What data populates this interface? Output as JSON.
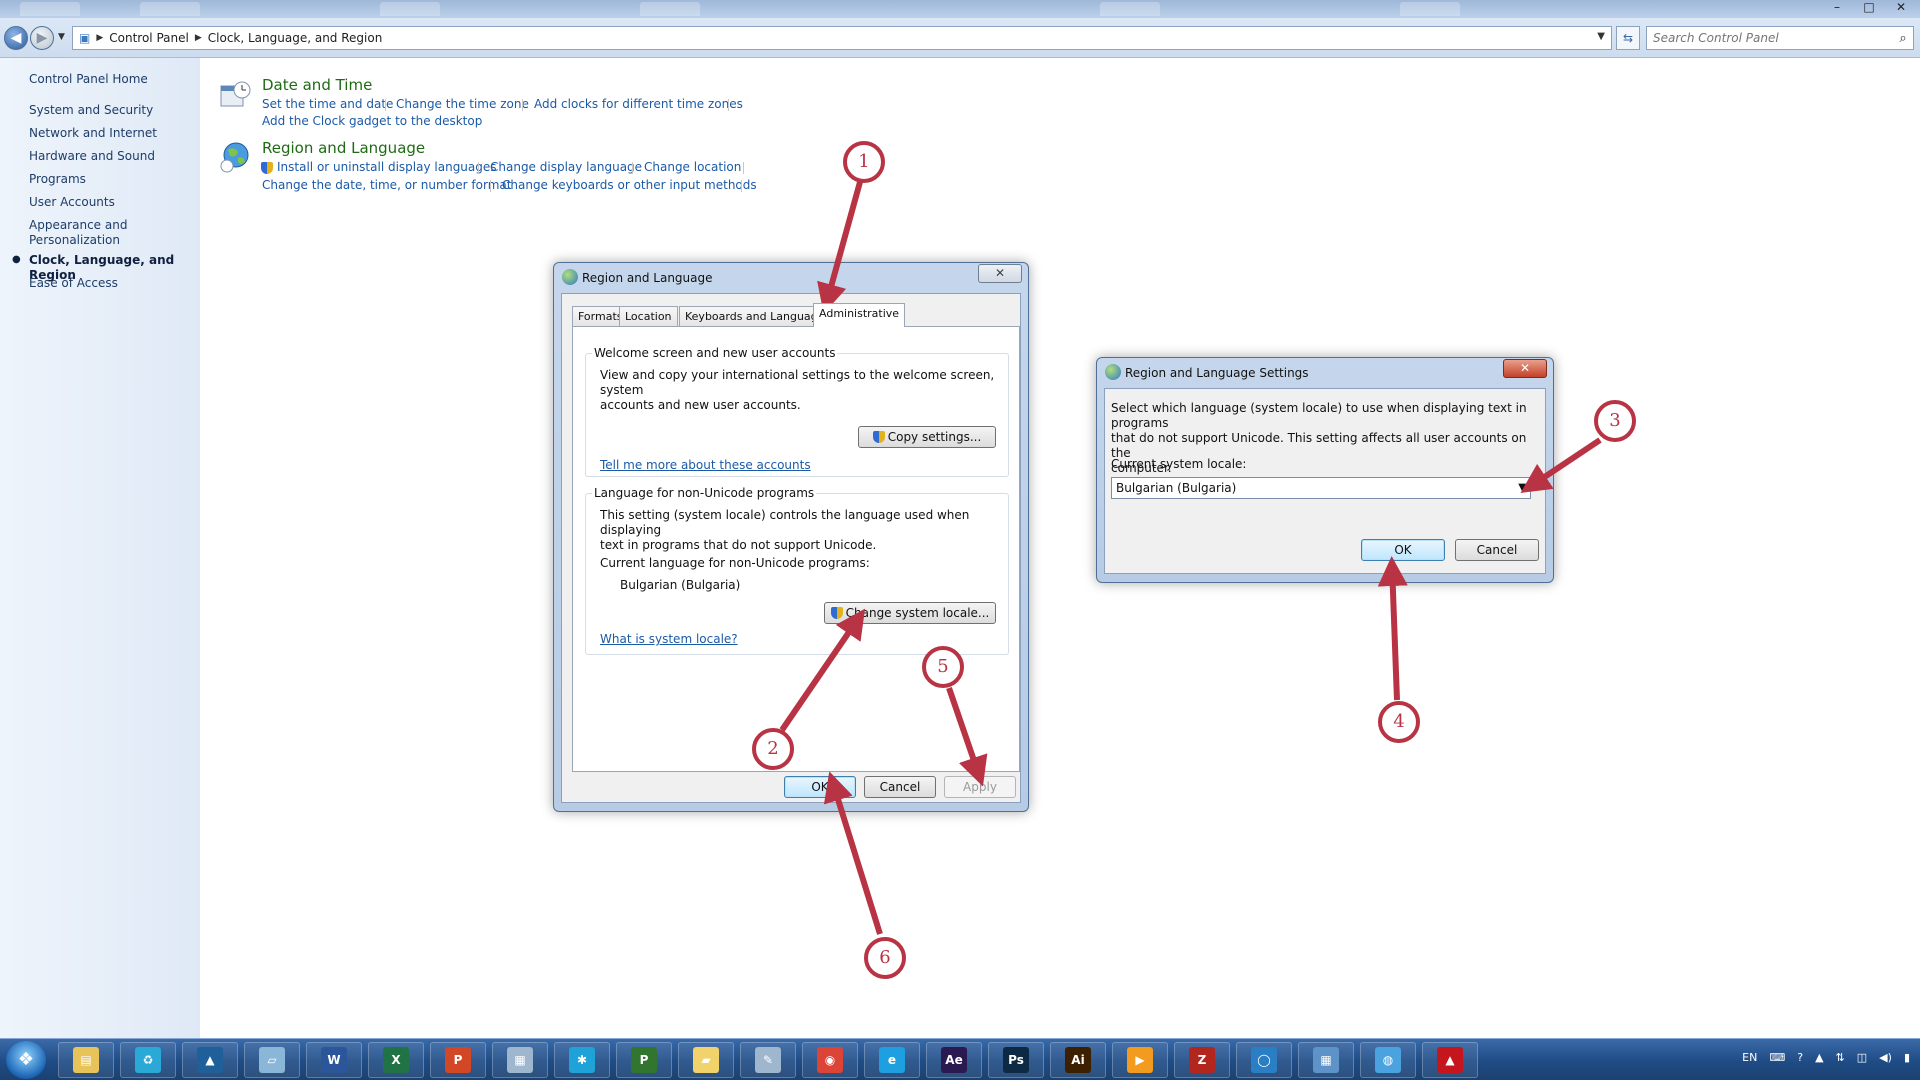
{
  "window": {
    "controls": [
      "–",
      "□",
      "✕"
    ]
  },
  "address_bar": {
    "breadcrumb": [
      "Control Panel",
      "Clock, Language, and Region"
    ],
    "search_placeholder": "Search Control Panel"
  },
  "sidebar": {
    "home": "Control Panel Home",
    "items": [
      {
        "label": "System and Security"
      },
      {
        "label": "Network and Internet"
      },
      {
        "label": "Hardware and Sound"
      },
      {
        "label": "Programs"
      },
      {
        "label": "User Accounts"
      },
      {
        "label": "Appearance and Personalization"
      },
      {
        "label": "Clock, Language, and Region",
        "active": true
      },
      {
        "label": "Ease of Access"
      }
    ]
  },
  "categories": {
    "date_time": {
      "title": "Date and Time",
      "links": [
        "Set the time and date",
        "Change the time zone",
        "Add clocks for different time zones",
        "Add the Clock gadget to the desktop"
      ]
    },
    "region_language": {
      "title": "Region and Language",
      "links": [
        "Install or uninstall display languages",
        "Change display language",
        "Change location",
        "Change the date, time, or number format",
        "Change keyboards or other input methods"
      ]
    }
  },
  "dialog_region": {
    "title": "Region and Language",
    "close": "✕",
    "tabs": [
      "Formats",
      "Location",
      "Keyboards and Languages",
      "Administrative"
    ],
    "active_tab": "Administrative",
    "welcome_group": {
      "label": "Welcome screen and new user accounts",
      "text_line1": "View and copy your international settings to the welcome screen, system",
      "text_line2": "accounts and new user accounts.",
      "copy_button": "Copy settings...",
      "link": "Tell me more about these accounts"
    },
    "nonunicode_group": {
      "label": "Language for non-Unicode programs",
      "text_line1": "This setting (system locale) controls the language used when displaying",
      "text_line2": "text in programs that do not support Unicode.",
      "current_label": "Current language for non-Unicode programs:",
      "current_value": "Bulgarian (Bulgaria)",
      "change_button": "Change system locale...",
      "link": "What is system locale?"
    },
    "buttons": {
      "ok": "OK",
      "cancel": "Cancel",
      "apply": "Apply"
    }
  },
  "dialog_settings": {
    "title": "Region and Language Settings",
    "close": "✕",
    "text_line1": "Select which language (system locale) to use when displaying text in programs",
    "text_line2": "that do not support Unicode. This setting affects all user accounts on the",
    "text_line3": "computer.",
    "locale_label": "Current system locale:",
    "locale_value": "Bulgarian (Bulgaria)",
    "buttons": {
      "ok": "OK",
      "cancel": "Cancel"
    }
  },
  "taskbar": {
    "apps": [
      {
        "icon": "explorer-icon",
        "glyph": "▤",
        "color": "#e7c35a"
      },
      {
        "icon": "recycle-icon",
        "glyph": "♻",
        "color": "#2aa9d6"
      },
      {
        "icon": "autocad-icon",
        "glyph": "▲",
        "color": "#1f5f9a"
      },
      {
        "icon": "notes-icon",
        "glyph": "▱",
        "color": "#8ab7d8"
      },
      {
        "icon": "word-icon",
        "glyph": "W",
        "color": "#2b579a"
      },
      {
        "icon": "excel-icon",
        "glyph": "X",
        "color": "#217346"
      },
      {
        "icon": "powerpoint-icon",
        "glyph": "P",
        "color": "#d24726"
      },
      {
        "icon": "calculator-icon",
        "glyph": "▦",
        "color": "#9fb6cf"
      },
      {
        "icon": "network-icon",
        "glyph": "✱",
        "color": "#1fa2d8"
      },
      {
        "icon": "project-icon",
        "glyph": "P",
        "color": "#31752f"
      },
      {
        "icon": "folder-icon",
        "glyph": "▰",
        "color": "#f2d36b"
      },
      {
        "icon": "paint-icon",
        "glyph": "✎",
        "color": "#9fb6cf"
      },
      {
        "icon": "chrome-icon",
        "glyph": "◉",
        "color": "#db4437"
      },
      {
        "icon": "ie-icon",
        "glyph": "e",
        "color": "#1ea0e0"
      },
      {
        "icon": "after-effects-icon",
        "glyph": "Ae",
        "color": "#2b1a4f"
      },
      {
        "icon": "photoshop-icon",
        "glyph": "Ps",
        "color": "#0d2a45"
      },
      {
        "icon": "illustrator-icon",
        "glyph": "Ai",
        "color": "#3d2000"
      },
      {
        "icon": "media-player-icon",
        "glyph": "▶",
        "color": "#f29b1e"
      },
      {
        "icon": "filezilla-icon",
        "glyph": "Z",
        "color": "#b3261e"
      },
      {
        "icon": "chat-icon",
        "glyph": "◯",
        "color": "#2a7fc4"
      },
      {
        "icon": "control-panel-icon",
        "glyph": "▦",
        "color": "#5d93c7"
      },
      {
        "icon": "region-globe-icon",
        "glyph": "◍",
        "color": "#4aa3df"
      },
      {
        "icon": "acrobat-icon",
        "glyph": "▲",
        "color": "#c4161c"
      }
    ],
    "tray": {
      "lang": "EN",
      "icons": [
        "⌨",
        "?",
        "▲",
        "⇅",
        "◫",
        "◀)",
        "▮"
      ]
    }
  },
  "annotations": {
    "markers": [
      "1",
      "2",
      "3",
      "4",
      "5",
      "6"
    ],
    "color": "#b83343"
  }
}
